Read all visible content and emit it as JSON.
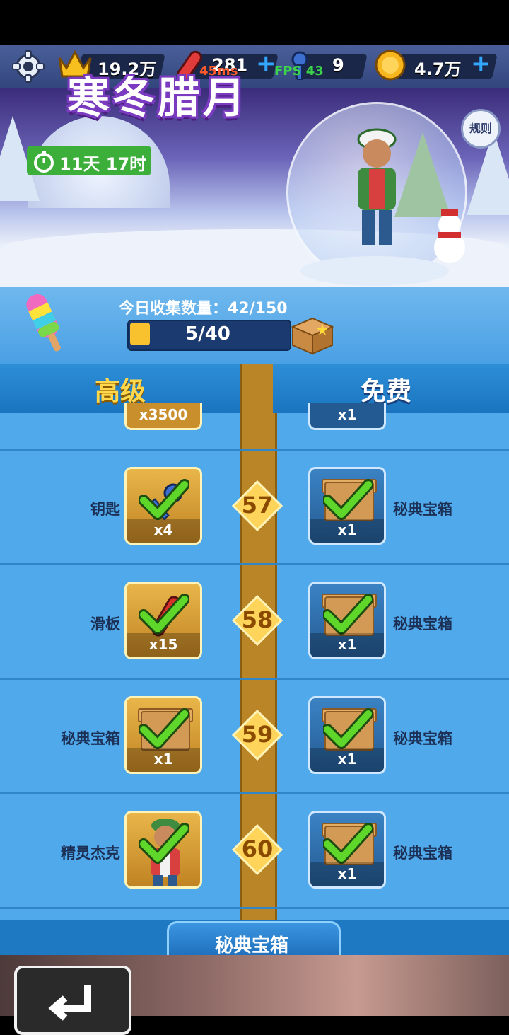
{
  "topbar": {
    "crowns": "19.2万",
    "boards": "281",
    "keys": "9",
    "coins": "4.7万",
    "ping": "45ms",
    "fps": "FPS 43"
  },
  "banner": {
    "title": "寒冬腊月",
    "timer": "11天 17时",
    "rules": "规则"
  },
  "collect": {
    "label": "今日收集数量：42/150",
    "progress": "5/40",
    "progress_fraction": 0.125
  },
  "tiers": {
    "premium": "高级",
    "free": "免费"
  },
  "partial_row": {
    "premium_count": "x3500",
    "free_count": "x1"
  },
  "rows": [
    {
      "level": "57",
      "premium_name": "钥匙",
      "premium_count": "x4",
      "free_name": "秘典宝箱",
      "free_count": "x1"
    },
    {
      "level": "58",
      "premium_name": "滑板",
      "premium_count": "x15",
      "free_name": "秘典宝箱",
      "free_count": "x1"
    },
    {
      "level": "59",
      "premium_name": "秘典宝箱",
      "premium_count": "x1",
      "free_name": "秘典宝箱",
      "free_count": "x1"
    },
    {
      "level": "60",
      "premium_name": "精灵杰克",
      "premium_count": "",
      "free_name": "秘典宝箱",
      "free_count": "x1"
    }
  ],
  "footer": {
    "tab": "秘典宝箱"
  },
  "icons": [
    "gear-icon",
    "crown-icon",
    "skateboard-icon",
    "key-icon",
    "coin-icon",
    "plus-icon",
    "stopwatch-icon",
    "popsicle-icon",
    "chest-icon",
    "check-icon",
    "back-icon"
  ],
  "colors": {
    "accent_gold": "#f8c22e",
    "check_green": "#46c21e",
    "list_blue": "#4fa9ea"
  }
}
